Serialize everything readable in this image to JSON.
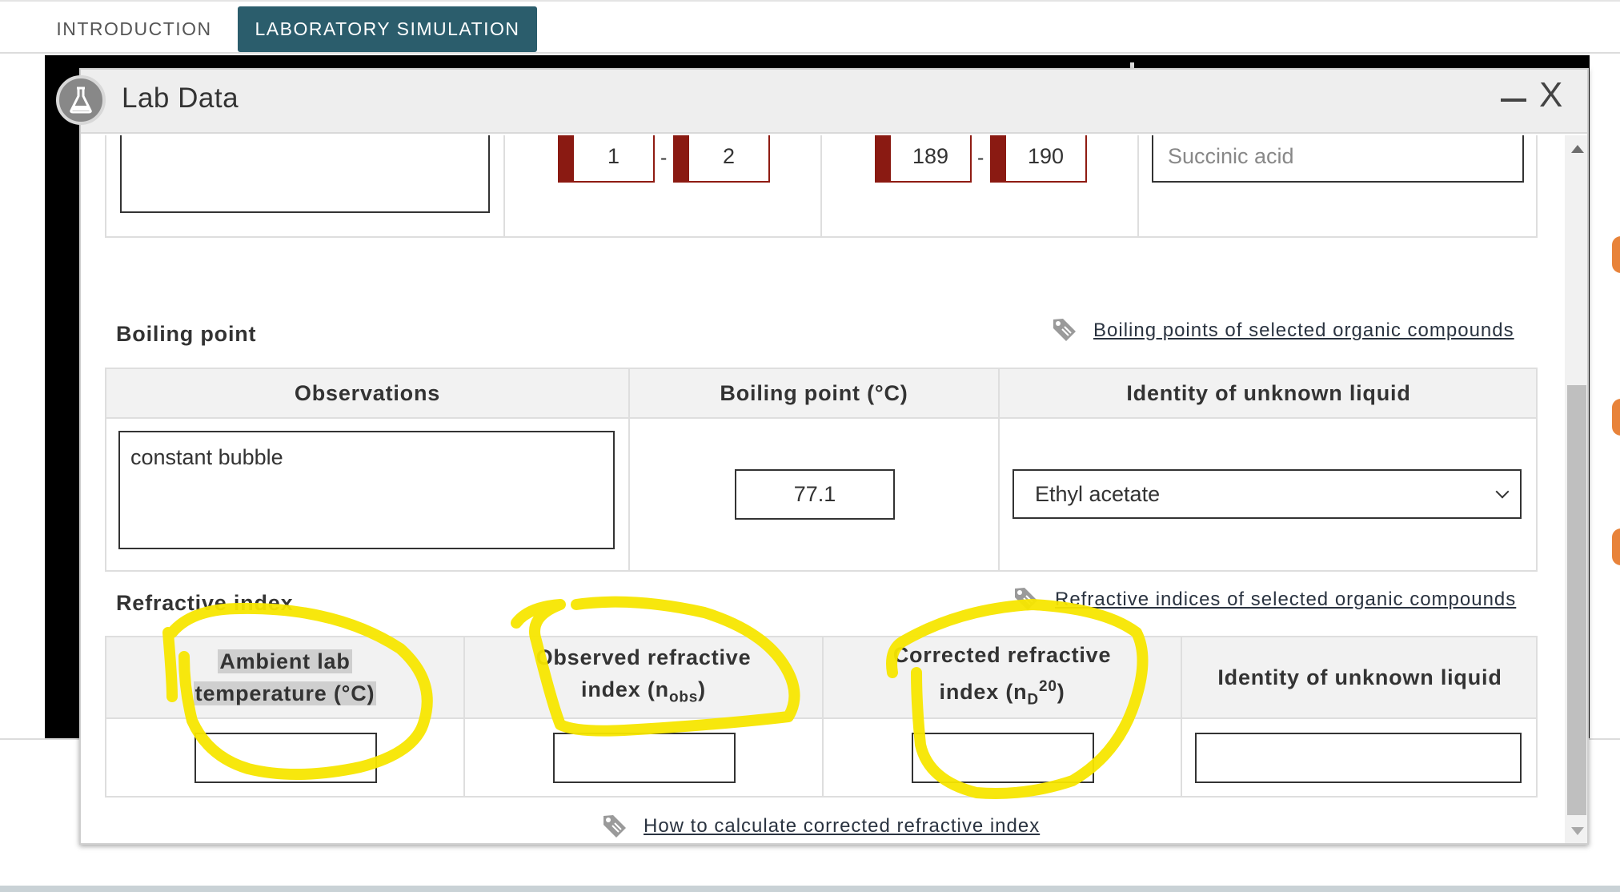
{
  "tabs": {
    "introduction": "INTRODUCTION",
    "laboratory_simulation": "LABORATORY SIMULATION"
  },
  "panel": {
    "title": "Lab Data",
    "minimize_label": "—",
    "close_label": "X"
  },
  "melting_point_row": {
    "range1_low": "1",
    "range1_high": "2",
    "range2_low": "189",
    "range2_high": "190",
    "dash": "-",
    "identity_placeholder": "Succinic acid"
  },
  "boiling_point": {
    "section_title": "Boiling point",
    "link": "Boiling points of selected organic compounds",
    "headers": [
      "Observations",
      "Boiling point (°C)",
      "Identity of unknown liquid"
    ],
    "observations_value": "constant bubble",
    "boiling_point_value": "77.1",
    "identity_selected": "Ethyl acetate"
  },
  "refractive_index": {
    "section_title": "Refractive index",
    "link": "Refractive indices of selected organic compounds",
    "header_ambient_line1": "Ambient lab",
    "header_ambient_line2": "temperature (°C)",
    "header_observed_line1": "Observed refractive",
    "header_observed_line2": "index (n",
    "header_observed_sub": "obs",
    "header_observed_close": ")",
    "header_corrected_line1": "Corrected refractive",
    "header_corrected_line2": "index (n",
    "header_corrected_sub": "D",
    "header_corrected_sup": "20",
    "header_corrected_close": ")",
    "header_identity": "Identity of unknown liquid",
    "how_to_link": "How to calculate corrected refractive index"
  },
  "colors": {
    "active_tab": "#2b5d6c",
    "melting_box_accent": "#8a1a12",
    "annotation_yellow": "#f7e600"
  },
  "icons": [
    "flask-icon",
    "tag-icon",
    "chevron-down-icon",
    "scroll-up-icon",
    "scroll-down-icon"
  ]
}
